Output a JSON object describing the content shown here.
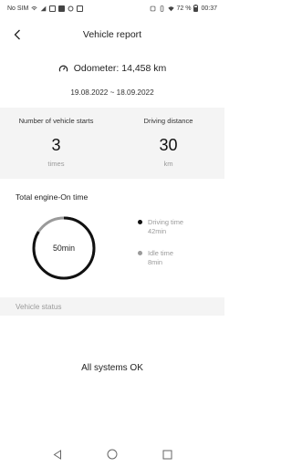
{
  "status_bar": {
    "carrier": "No SIM",
    "battery": "72 %",
    "time": "00:37"
  },
  "header": {
    "title": "Vehicle report",
    "back_icon": "chevron-left-icon"
  },
  "odometer": {
    "icon": "gauge-icon",
    "text": "Odometer: 14,458 km"
  },
  "date_range": "19.08.2022 ~ 18.09.2022",
  "stats": [
    {
      "label": "Number of vehicle starts",
      "value": "3",
      "unit": "times"
    },
    {
      "label": "Driving distance",
      "value": "30",
      "unit": "km"
    }
  ],
  "engine": {
    "title": "Total engine-On time",
    "total": "50min",
    "legend": [
      {
        "label": "Driving time",
        "value": "42min",
        "color": "#111111"
      },
      {
        "label": "Idle time",
        "value": "8min",
        "color": "#9a9a9a"
      }
    ],
    "driving_fraction": 0.84
  },
  "vehicle_status": {
    "title": "Vehicle status",
    "message": "All systems OK"
  },
  "nav": {
    "back_icon": "triangle-back-icon",
    "home_icon": "circle-home-icon",
    "recents_icon": "square-recents-icon"
  }
}
